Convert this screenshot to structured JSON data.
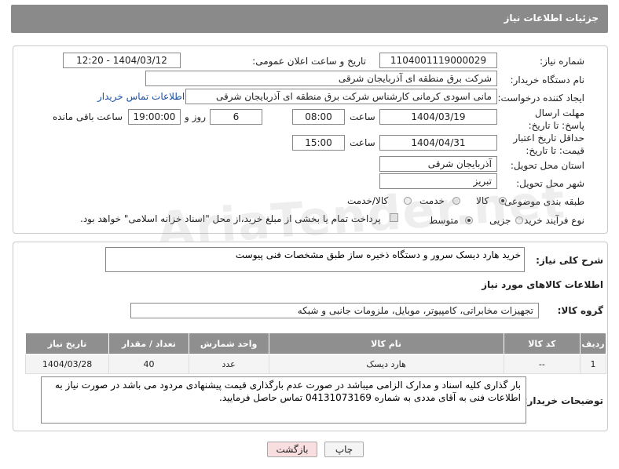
{
  "header": {
    "title": "جزئیات اطلاعات نیاز"
  },
  "fields": {
    "need_number_label": "شماره نیاز:",
    "need_number": "1104001119000029",
    "announce_label": "تاریخ و ساعت اعلان عمومی:",
    "announce_value": "1404/03/12 - 12:20",
    "buyer_label": "نام دستگاه خریدار:",
    "buyer": "شرکت برق منطقه ای آذربایجان شرقی",
    "creator_label": "ایجاد کننده درخواست:",
    "creator": "مانی اسودی کرمانی کارشناس شرکت برق منطقه ای آذربایجان شرقی",
    "contact_link": "اطلاعات تماس خریدار",
    "deadline_label": "مهلت ارسال پاسخ: تا تاریخ:",
    "deadline_date": "1404/03/19",
    "time_label": "ساعت",
    "deadline_time": "08:00",
    "days_value": "6",
    "days_label": "روز و",
    "remaining_time": "19:00:00",
    "remaining_label": "ساعت باقی مانده",
    "validity_label": "حداقل تاریخ اعتبار قیمت: تا تاریخ:",
    "validity_date": "1404/04/31",
    "validity_time": "15:00",
    "province_label": "استان محل تحویل:",
    "province": "آذربایجان شرقی",
    "city_label": "شهر محل تحویل:",
    "city": "تبریز",
    "category_label": "طبقه بندی موضوعی:",
    "category_options": [
      "کالا",
      "خدمت",
      "کالا/خدمت"
    ],
    "process_label": "نوع فرآیند خرید :",
    "process_options": [
      "جزیی",
      "متوسط"
    ],
    "payment_note": "پرداخت تمام یا بخشی از مبلغ خرید،از محل \"اسناد خزانه اسلامی\" خواهد بود."
  },
  "summary": {
    "label": "شرح کلی نیاز:",
    "text": "خرید هارد دیسک سرور و دستگاه ذخیره ساز طبق مشخصات فنی پیوست"
  },
  "goods": {
    "section_title": "اطلاعات کالاهای مورد نیاز",
    "group_label": "گروه کالا:",
    "group_value": "تجهیزات مخابراتی، کامپیوتر، موبایل، ملزومات جانبی و شبکه",
    "columns": [
      "ردیف",
      "کد کالا",
      "نام کالا",
      "واحد شمارش",
      "تعداد / مقدار",
      "تاریخ نیاز"
    ],
    "rows": [
      {
        "row": "1",
        "code": "--",
        "name": "هارد دیسک",
        "unit": "عدد",
        "qty": "40",
        "date": "1404/03/28"
      }
    ]
  },
  "buyer_notes": {
    "label": "توضیحات خریدار:",
    "text": "بار گذاری کلیه اسناد و مدارک الزامی میباشد در صورت عدم بارگذاری قیمت پیشنهادی مردود می باشد در صورت نیاز به اطلاعات فنی به آقای مددی به شماره 04131073169 تماس حاصل فرمایید."
  },
  "buttons": {
    "print": "چاپ",
    "back": "بازگشت"
  },
  "watermark": "AriaTender.net",
  "colors": {
    "header": "#8a8a8a",
    "link": "#1a4fa0",
    "back_button": "#f8dede"
  }
}
